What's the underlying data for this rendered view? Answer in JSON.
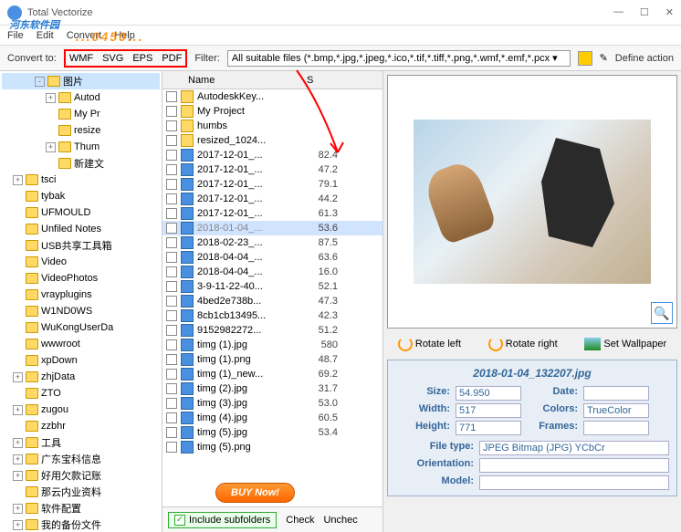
{
  "window": {
    "title": "Total Vectorize",
    "watermark": "河东软件园",
    "watermark_sub": "...0450..."
  },
  "menu": {
    "file": "File",
    "edit": "Edit",
    "convert": "Convert",
    "help": "Help"
  },
  "toolbar": {
    "convert_to": "Convert to:",
    "formats": {
      "wmf": "WMF",
      "svg": "SVG",
      "eps": "EPS",
      "pdf": "PDF"
    },
    "filter_label": "Filter:",
    "filter_value": "All suitable files (*.bmp,*.jpg,*.jpeg,*.ico,*.tif,*.tiff,*.png,*.wmf,*.emf,*.pcx ▾",
    "define_action": "Define action"
  },
  "tree": [
    {
      "indent": 3,
      "exp": "-",
      "label": "图片",
      "sel": true
    },
    {
      "indent": 4,
      "exp": "+",
      "label": "Autod"
    },
    {
      "indent": 4,
      "exp": "",
      "label": "My Pr"
    },
    {
      "indent": 4,
      "exp": "",
      "label": "resize"
    },
    {
      "indent": 4,
      "exp": "+",
      "label": "Thum"
    },
    {
      "indent": 4,
      "exp": "",
      "label": "新建文"
    },
    {
      "indent": 1,
      "exp": "+",
      "label": "tsci"
    },
    {
      "indent": 1,
      "exp": "",
      "label": "tybak"
    },
    {
      "indent": 1,
      "exp": "",
      "label": "UFMOULD"
    },
    {
      "indent": 1,
      "exp": "",
      "label": "Unfiled Notes"
    },
    {
      "indent": 1,
      "exp": "",
      "label": "USB共享工具箱"
    },
    {
      "indent": 1,
      "exp": "",
      "label": "Video"
    },
    {
      "indent": 1,
      "exp": "",
      "label": "VideoPhotos"
    },
    {
      "indent": 1,
      "exp": "",
      "label": "vrayplugins"
    },
    {
      "indent": 1,
      "exp": "",
      "label": "W1ND0WS"
    },
    {
      "indent": 1,
      "exp": "",
      "label": "WuKongUserDa"
    },
    {
      "indent": 1,
      "exp": "",
      "label": "wwwroot"
    },
    {
      "indent": 1,
      "exp": "",
      "label": "xpDown"
    },
    {
      "indent": 1,
      "exp": "+",
      "label": "zhjData"
    },
    {
      "indent": 1,
      "exp": "",
      "label": "ZTO"
    },
    {
      "indent": 1,
      "exp": "+",
      "label": "zugou"
    },
    {
      "indent": 1,
      "exp": "",
      "label": "zzbhr"
    },
    {
      "indent": 1,
      "exp": "+",
      "label": "工具"
    },
    {
      "indent": 1,
      "exp": "+",
      "label": "广东宝科信息"
    },
    {
      "indent": 1,
      "exp": "+",
      "label": "好用欠款记账"
    },
    {
      "indent": 1,
      "exp": "",
      "label": "那云内业资料"
    },
    {
      "indent": 1,
      "exp": "+",
      "label": "软件配置"
    },
    {
      "indent": 1,
      "exp": "+",
      "label": "我的备份文件"
    }
  ],
  "filehead": {
    "name": "Name",
    "size": "S"
  },
  "files": [
    {
      "type": "dir",
      "name": "AutodeskKey...",
      "size": ""
    },
    {
      "type": "dir",
      "name": "My Project",
      "size": ""
    },
    {
      "type": "dir",
      "name": "humbs",
      "size": ""
    },
    {
      "type": "dir",
      "name": "resized_1024...",
      "size": ""
    },
    {
      "type": "img",
      "name": "2017-12-01_...",
      "size": "82.4"
    },
    {
      "type": "img",
      "name": "2017-12-01_...",
      "size": "47.2"
    },
    {
      "type": "img",
      "name": "2017-12-01_...",
      "size": "79.1"
    },
    {
      "type": "img",
      "name": "2017-12-01_...",
      "size": "44.2"
    },
    {
      "type": "img",
      "name": "2017-12-01_...",
      "size": "61.3"
    },
    {
      "type": "img",
      "name": "2018-01-04_...",
      "size": "53.6",
      "sel": true
    },
    {
      "type": "img",
      "name": "2018-02-23_...",
      "size": "87.5"
    },
    {
      "type": "img",
      "name": "2018-04-04_...",
      "size": "63.6"
    },
    {
      "type": "img",
      "name": "2018-04-04_...",
      "size": "16.0"
    },
    {
      "type": "img",
      "name": "3-9-11-22-40...",
      "size": "52.1"
    },
    {
      "type": "img",
      "name": "4bed2e738b...",
      "size": "47.3"
    },
    {
      "type": "img",
      "name": "8cb1cb13495...",
      "size": "42.3"
    },
    {
      "type": "img",
      "name": "9152982272...",
      "size": "51.2"
    },
    {
      "type": "img",
      "name": "timg (1).jpg",
      "size": "580"
    },
    {
      "type": "img",
      "name": "timg (1).png",
      "size": "48.7"
    },
    {
      "type": "img",
      "name": "timg (1)_new...",
      "size": "69.2"
    },
    {
      "type": "img",
      "name": "timg (2).jpg",
      "size": "31.7"
    },
    {
      "type": "img",
      "name": "timg (3).jpg",
      "size": "53.0"
    },
    {
      "type": "img",
      "name": "timg (4).jpg",
      "size": "60.5"
    },
    {
      "type": "img",
      "name": "timg (5).jpg",
      "size": "53.4"
    },
    {
      "type": "img",
      "name": "timg (5).png",
      "size": ""
    }
  ],
  "buy": "BUY Now!",
  "include_sub": "Include subfolders",
  "check": "Check",
  "uncheck": "Unchec",
  "rotate": {
    "left": "Rotate left",
    "right": "Rotate right",
    "wall": "Set Wallpaper"
  },
  "info": {
    "title": "2018-01-04_132207.jpg",
    "size_k": "Size:",
    "size_v": "54.950",
    "date_k": "Date:",
    "date_v": "",
    "width_k": "Width:",
    "width_v": "517",
    "colors_k": "Colors:",
    "colors_v": "TrueColor",
    "height_k": "Height:",
    "height_v": "771",
    "frames_k": "Frames:",
    "frames_v": "",
    "filetype_k": "File type:",
    "filetype_v": "JPEG Bitmap (JPG) YCbCr",
    "orient_k": "Orientation:",
    "orient_v": "",
    "model_k": "Model:",
    "model_v": ""
  }
}
